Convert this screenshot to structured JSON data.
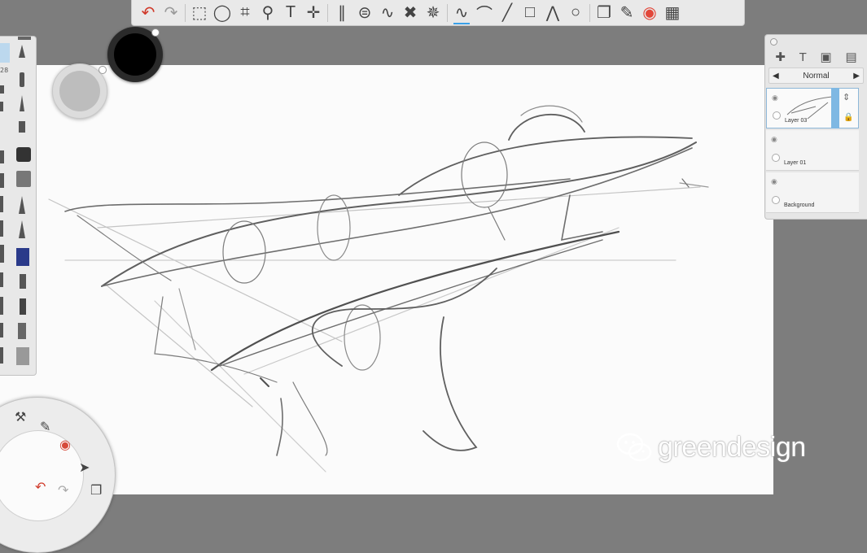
{
  "toolbar": {
    "tools": [
      {
        "name": "undo-icon",
        "glyph": "↶",
        "color": "#d03a2a"
      },
      {
        "name": "redo-icon",
        "glyph": "↷",
        "color": "#9a9a9a"
      },
      {
        "name": "rect-select-icon",
        "glyph": "⬚"
      },
      {
        "name": "lasso-icon",
        "glyph": "◯"
      },
      {
        "name": "crop-icon",
        "glyph": "⌗"
      },
      {
        "name": "zoom-icon",
        "glyph": "⚲"
      },
      {
        "name": "text-icon",
        "glyph": "T"
      },
      {
        "name": "move-icon",
        "glyph": "✛"
      },
      {
        "name": "ruler-icon",
        "glyph": "∥"
      },
      {
        "name": "ellipse-guide-icon",
        "glyph": "⊜"
      },
      {
        "name": "french-curve-icon",
        "glyph": "∿"
      },
      {
        "name": "symmetry-icon",
        "glyph": "✖"
      },
      {
        "name": "radial-symmetry-icon",
        "glyph": "✵"
      },
      {
        "name": "freehand-line-icon",
        "glyph": "∿",
        "active": true
      },
      {
        "name": "curve-line-icon",
        "glyph": "⌒"
      },
      {
        "name": "straight-line-icon",
        "glyph": "╱"
      },
      {
        "name": "rectangle-icon",
        "glyph": "□"
      },
      {
        "name": "polyline-icon",
        "glyph": "⋀"
      },
      {
        "name": "circle-icon",
        "glyph": "○"
      },
      {
        "name": "copy-paste-icon",
        "glyph": "❐"
      },
      {
        "name": "brush-library-icon",
        "glyph": "✎"
      },
      {
        "name": "color-wheel-icon",
        "glyph": "◉",
        "color": "#e2473a"
      },
      {
        "name": "color-puck-icon",
        "glyph": "▦"
      }
    ]
  },
  "brushbar": {
    "size_label": "28"
  },
  "layers": {
    "blend_mode": "Normal",
    "items": [
      {
        "name": "Layer 03",
        "selected": true
      },
      {
        "name": "Layer 01",
        "selected": false
      },
      {
        "name": "Background",
        "selected": false
      }
    ]
  },
  "watermark": {
    "text": "greendesign"
  },
  "colors": {
    "canvas": "#fbfbfb",
    "workspace": "#7d7d7d",
    "accent": "#3aa0e8"
  }
}
